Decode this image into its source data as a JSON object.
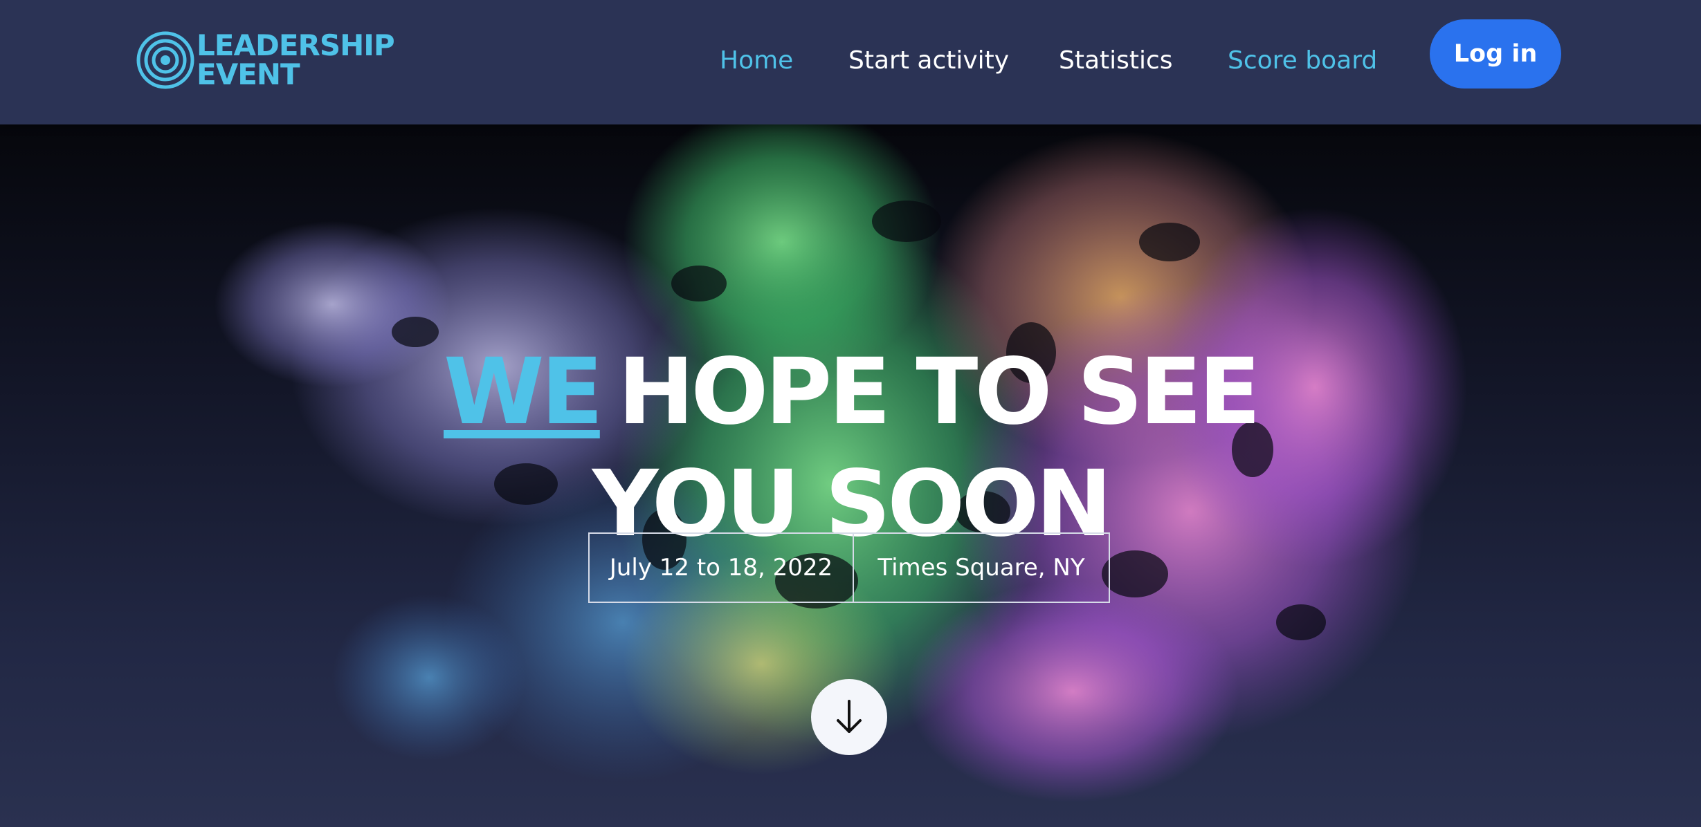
{
  "brand": {
    "line1": "LEADERSHIP",
    "line2": "EVENT",
    "icon": "concentric-circles-icon",
    "color": "#4fc2e8"
  },
  "nav": {
    "items": [
      {
        "label": "Home",
        "active": true
      },
      {
        "label": "Start activity",
        "active": false
      },
      {
        "label": "Statistics",
        "active": false
      },
      {
        "label": "Score board",
        "active": true
      }
    ],
    "login_label": "Log in"
  },
  "hero": {
    "title_highlight": "WE",
    "title_rest_line1": "HOPE TO SEE",
    "title_line2": "YOU SOON",
    "date": "July 12 to 18, 2022",
    "location": "Times Square, NY",
    "scroll_icon": "arrow-down-icon"
  },
  "colors": {
    "accent": "#4fc2e8",
    "button": "#2a72ee",
    "navbar": "#2b3355",
    "text": "#ffffff"
  }
}
